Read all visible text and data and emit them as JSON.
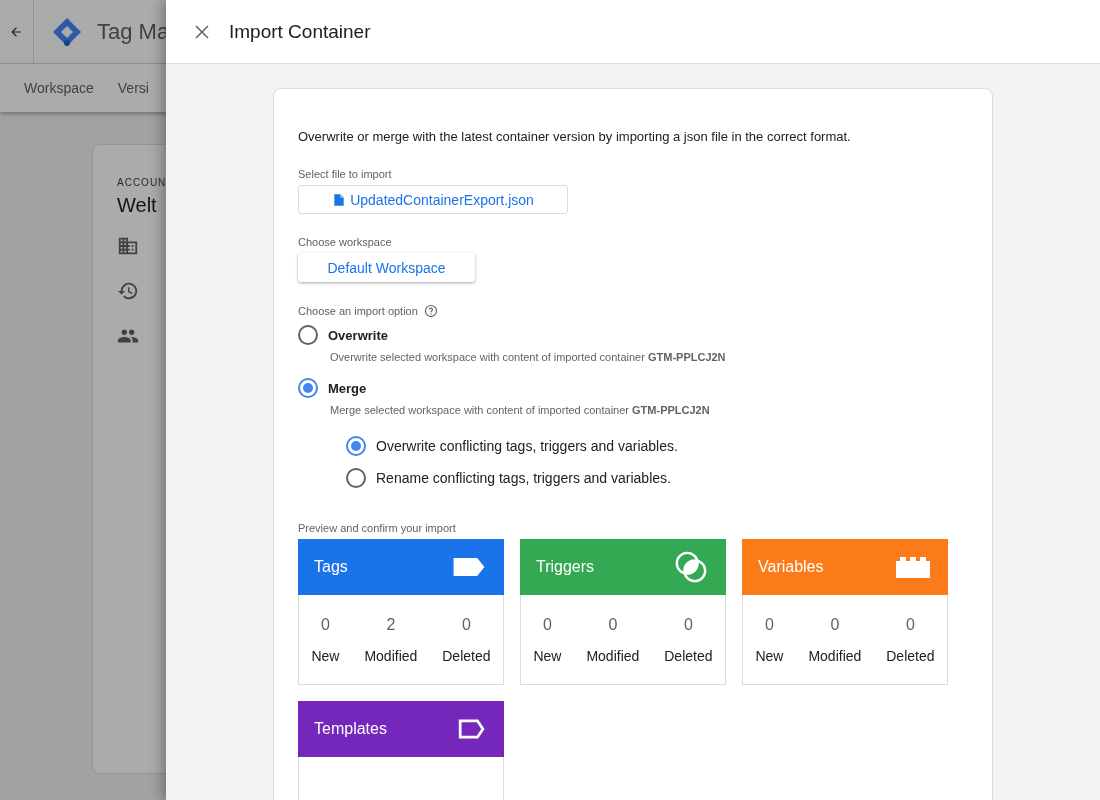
{
  "background": {
    "app_title": "Tag Ma",
    "nav_tabs": [
      "Workspace",
      "Versi"
    ],
    "account_card": {
      "label": "ACCOUN",
      "name": "Welt"
    }
  },
  "dialog": {
    "title": "Import Container",
    "intro": "Overwrite or merge with the latest container version by importing a json file in the correct format.",
    "file_label": "Select file to import",
    "file_name": "UpdatedContainerExport.json",
    "workspace_label": "Choose workspace",
    "workspace_button": "Default Workspace",
    "import_option_label": "Choose an import option",
    "options": [
      {
        "label": "Overwrite",
        "description": "Overwrite selected workspace with content of imported container **GTM-PPLCJ2N**",
        "selected": false
      },
      {
        "label": "Merge",
        "description": "Merge selected workspace with content of imported container **GTM-PPLCJ2N**",
        "selected": true,
        "sub_options": [
          {
            "label": "Overwrite conflicting tags, triggers and variables.",
            "selected": true
          },
          {
            "label": "Rename conflicting tags, triggers and variables.",
            "selected": false
          }
        ]
      }
    ],
    "preview_label": "Preview and confirm your import",
    "categories": [
      {
        "title": "Tags",
        "kind": "tag",
        "color": "#1a73e8",
        "stats": [
          {
            "value": "0",
            "label": "New"
          },
          {
            "value": "2",
            "label": "Modified"
          },
          {
            "value": "0",
            "label": "Deleted"
          }
        ]
      },
      {
        "title": "Triggers",
        "kind": "trigger",
        "color": "#34a853",
        "stats": [
          {
            "value": "0",
            "label": "New"
          },
          {
            "value": "0",
            "label": "Modified"
          },
          {
            "value": "0",
            "label": "Deleted"
          }
        ]
      },
      {
        "title": "Variables",
        "kind": "variable",
        "color": "#fa7b17",
        "stats": [
          {
            "value": "0",
            "label": "New"
          },
          {
            "value": "0",
            "label": "Modified"
          },
          {
            "value": "0",
            "label": "Deleted"
          }
        ]
      },
      {
        "title": "Templates",
        "kind": "template",
        "color": "#7627bb"
      }
    ]
  }
}
